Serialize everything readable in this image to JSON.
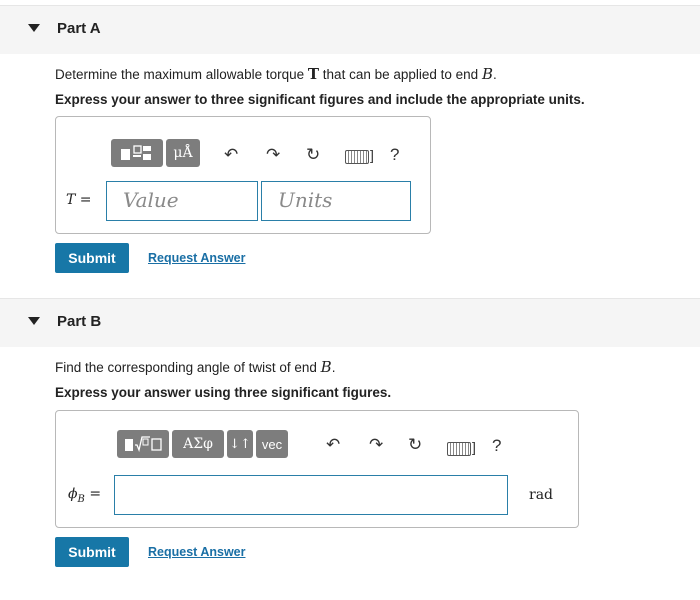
{
  "part_a": {
    "title": "Part A",
    "question_prefix": "Determine the maximum allowable torque ",
    "question_symbol": "T",
    "question_mid": " that can be applied to end ",
    "question_end_symbol": "B",
    "question_suffix": ".",
    "instruction": "Express your answer to three significant figures and include the appropriate units.",
    "toolbar": {
      "units_button": "μÅ",
      "help": "?",
      "kbd_bracket": "]"
    },
    "label_var": "T",
    "label_eq": " =",
    "value_placeholder": "Value",
    "units_placeholder": "Units",
    "submit_label": "Submit",
    "request_label": "Request Answer"
  },
  "part_b": {
    "title": "Part B",
    "question_prefix": "Find the corresponding angle of twist of end ",
    "question_symbol": "B",
    "question_suffix": ".",
    "instruction": "Express your answer using three significant figures.",
    "toolbar": {
      "greek_button": "ΑΣφ",
      "arrows_button": "↓↑",
      "vec_button": "vec",
      "help": "?",
      "kbd_bracket": "]"
    },
    "label_var": "ϕ",
    "label_sub": "B",
    "label_eq": " =",
    "unit": "rad",
    "submit_label": "Submit",
    "request_label": "Request Answer"
  }
}
